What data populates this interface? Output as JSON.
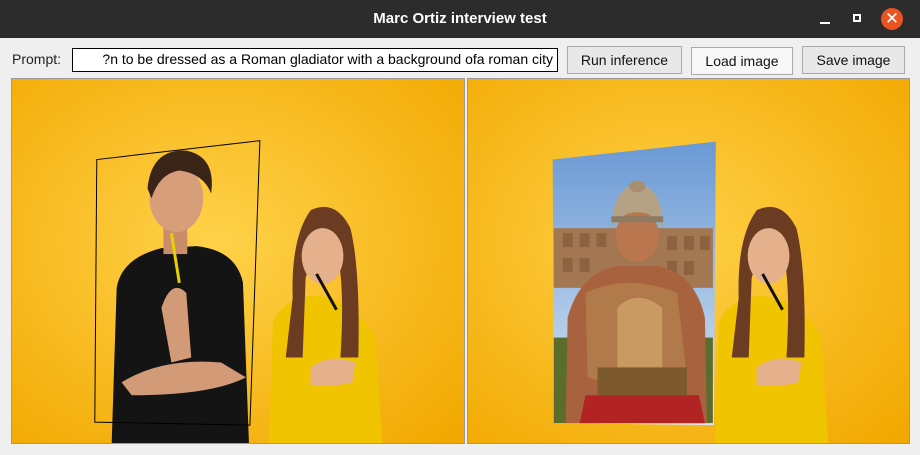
{
  "window": {
    "title": "Marc Ortiz interview test"
  },
  "toolbar": {
    "prompt_label": "Prompt:",
    "prompt_value": "n to be dressed as a Roman gladiator with a background ofa roman city?",
    "run_label": "Run inference",
    "load_label": "Load image",
    "save_label": "Save image"
  },
  "icons": {
    "minimize": "minimize-icon",
    "maximize": "maximize-icon",
    "close": "close-icon"
  },
  "colors": {
    "titlebar": "#2c2c2c",
    "close_button": "#e95420",
    "image_background": "#f6b902"
  }
}
